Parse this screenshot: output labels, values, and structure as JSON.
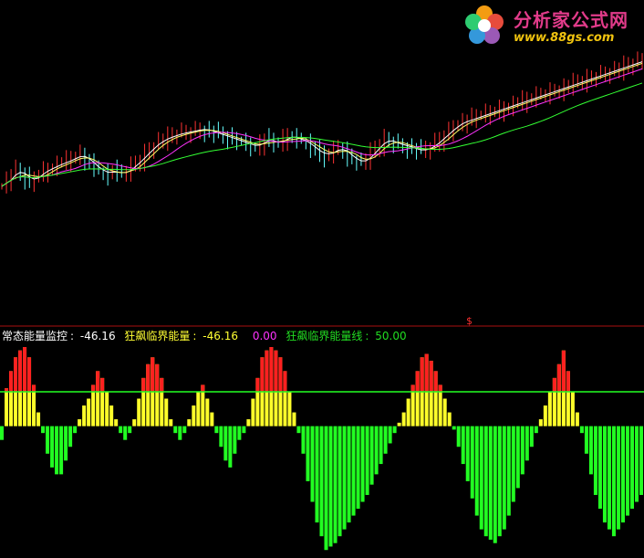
{
  "logo": {
    "title": "分析家公式网",
    "url": "www.88gs.com"
  },
  "signal_mark": "$",
  "legend": {
    "items": [
      {
        "label": "常态能量监控",
        "sep": ":",
        "value": "-46.16",
        "color": "#ffffff"
      },
      {
        "label": "狂飙临界能量",
        "sep": ":",
        "value": "-46.16",
        "color": "#ffff33"
      },
      {
        "label": "",
        "sep": "",
        "value": "0.00",
        "color": "#ff33ff"
      },
      {
        "label": "狂飙临界能量线",
        "sep": ":",
        "value": "50.00",
        "color": "#22dd22"
      }
    ]
  },
  "colors": {
    "positive_bar": "#ffff2a",
    "negative_bar": "#22ff22",
    "threshold_line": "#22ff22",
    "alert_bar": "#ff2020",
    "divider": "#aa1111",
    "ma_short": "#ffffff",
    "ma_mid": "#ffff66",
    "ma_long": "#ff33ff",
    "ma_slow": "#33ff33",
    "up_candle": "#ff3333",
    "down_candle": "#66ffff"
  },
  "chart_data": [
    {
      "type": "line",
      "name": "price-panel",
      "note_series": "candlestick with moving averages",
      "x": [
        0,
        1,
        2,
        3,
        4,
        5,
        6,
        7,
        8,
        9,
        10,
        11,
        12,
        13,
        14,
        15,
        16,
        17,
        18,
        19,
        20,
        21,
        22,
        23,
        24,
        25,
        26,
        27,
        28,
        29,
        30,
        31,
        32,
        33,
        34,
        35,
        36,
        37,
        38,
        39,
        40,
        41,
        42,
        43,
        44,
        45,
        46,
        47,
        48,
        49,
        50,
        51,
        52,
        53,
        54,
        55,
        56,
        57,
        58,
        59,
        60,
        61,
        62,
        63,
        64,
        65,
        66,
        67,
        68,
        69,
        70,
        71,
        72,
        73,
        74,
        75,
        76,
        77,
        78,
        79,
        80,
        81,
        82,
        83,
        84,
        85,
        86,
        87,
        88,
        89,
        90,
        91,
        92,
        93,
        94,
        95,
        96,
        97,
        98,
        99,
        100,
        101,
        102,
        103,
        104,
        105,
        106,
        107,
        108,
        109,
        110,
        111,
        112,
        113,
        114,
        115,
        116,
        117,
        118,
        119,
        120,
        121,
        122,
        123,
        124,
        125,
        126,
        127,
        128,
        129,
        130,
        131,
        132,
        133,
        134,
        135,
        136,
        137,
        138,
        139,
        140
      ],
      "series": [
        {
          "key": "close",
          "values": [
            130,
            138,
            145,
            150,
            148,
            142,
            136,
            140,
            146,
            150,
            152,
            155,
            158,
            160,
            162,
            165,
            168,
            170,
            166,
            160,
            155,
            150,
            148,
            146,
            150,
            148,
            145,
            150,
            155,
            160,
            165,
            172,
            178,
            182,
            188,
            190,
            192,
            195,
            196,
            198,
            199,
            200,
            201,
            203,
            202,
            200,
            198,
            196,
            194,
            192,
            190,
            188,
            186,
            184,
            182,
            180,
            185,
            190,
            188,
            186,
            184,
            190,
            195,
            192,
            190,
            188,
            186,
            180,
            175,
            172,
            170,
            172,
            175,
            180,
            175,
            170,
            165,
            162,
            160,
            165,
            172,
            178,
            184,
            190,
            188,
            185,
            183,
            182,
            180,
            178,
            176,
            175,
            178,
            180,
            185,
            190,
            196,
            200,
            206,
            210,
            212,
            214,
            216,
            218,
            220,
            222,
            224,
            226,
            228,
            230,
            232,
            234,
            236,
            238,
            240,
            242,
            244,
            246,
            248,
            250,
            252,
            254,
            256,
            258,
            260,
            262,
            264,
            266,
            268,
            270,
            272,
            274,
            276,
            278,
            280,
            282,
            284,
            286,
            288,
            290
          ]
        },
        {
          "key": "ma_short",
          "values": []
        },
        {
          "key": "ma_mid",
          "values": []
        },
        {
          "key": "ma_long",
          "values": []
        },
        {
          "key": "ma_slow",
          "values": []
        }
      ]
    },
    {
      "type": "bar",
      "name": "energy-indicator",
      "threshold": 50,
      "ylim": [
        -185,
        115
      ],
      "values": [
        -20,
        55,
        80,
        100,
        110,
        115,
        100,
        60,
        20,
        -10,
        -40,
        -60,
        -70,
        -70,
        -50,
        -30,
        -10,
        10,
        30,
        40,
        60,
        80,
        70,
        50,
        30,
        10,
        -10,
        -20,
        -10,
        10,
        40,
        70,
        90,
        100,
        90,
        70,
        40,
        10,
        -10,
        -20,
        -10,
        10,
        30,
        50,
        60,
        40,
        20,
        -10,
        -30,
        -50,
        -60,
        -40,
        -20,
        -10,
        10,
        40,
        70,
        100,
        110,
        115,
        110,
        100,
        80,
        50,
        20,
        -10,
        -40,
        -80,
        -110,
        -140,
        -160,
        -180,
        -175,
        -170,
        -160,
        -150,
        -140,
        -130,
        -120,
        -110,
        -100,
        -85,
        -70,
        -55,
        -40,
        -25,
        -10,
        5,
        20,
        40,
        60,
        80,
        100,
        105,
        95,
        80,
        60,
        40,
        20,
        -5,
        -30,
        -55,
        -80,
        -105,
        -130,
        -150,
        -160,
        -165,
        -170,
        -160,
        -150,
        -130,
        -110,
        -90,
        -70,
        -50,
        -30,
        -10,
        10,
        30,
        50,
        70,
        90,
        110,
        80,
        50,
        20,
        -10,
        -40,
        -70,
        -100,
        -120,
        -140,
        -150,
        -160,
        -150,
        -140,
        -130,
        -120,
        -110,
        -100
      ]
    }
  ]
}
